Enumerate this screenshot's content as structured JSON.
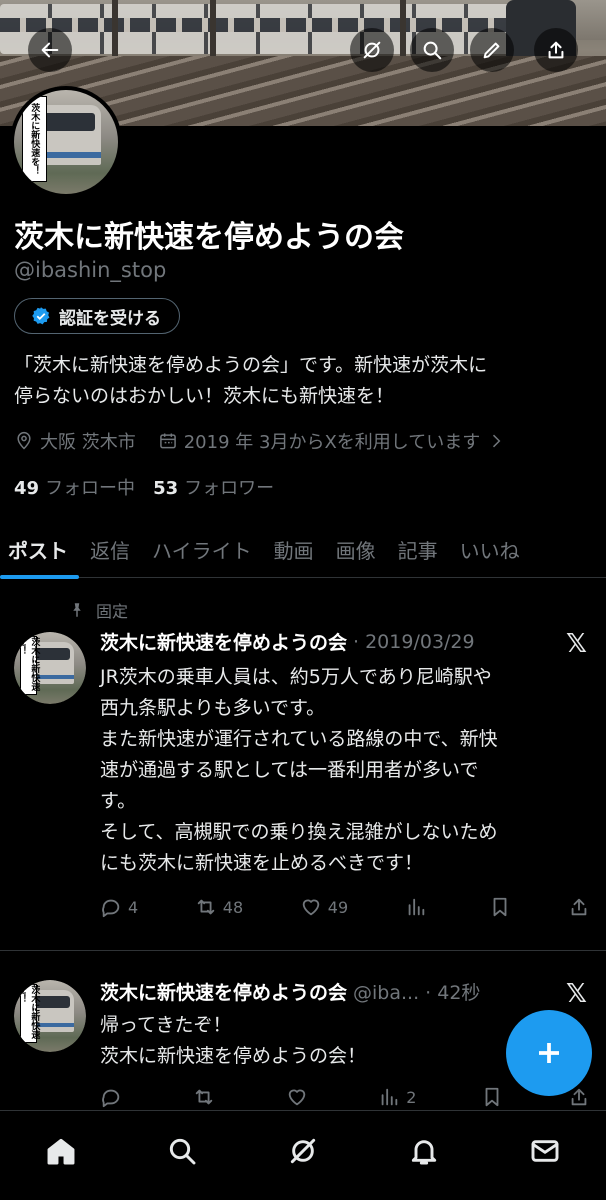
{
  "profile": {
    "name": "茨木に新快速を停めようの会",
    "handle": "@ibashin_stop",
    "verify_label": "認証を受ける",
    "bio_line1": "「茨木に新快速を停めようの会」です。新快速が茨木に",
    "bio_line2": "停らないのはおかしい！茨木にも新快速を！",
    "location": "大阪 茨木市",
    "joined": "2019 年 3月からXを利用しています",
    "following_count": "49",
    "following_label": "フォロー中",
    "followers_count": "53",
    "followers_label": "フォロワー",
    "avatar_text": "茨木に新快速を！"
  },
  "tabs": [
    "ポスト",
    "返信",
    "ハイライト",
    "動画",
    "画像",
    "記事",
    "いいね"
  ],
  "posts": [
    {
      "pinned_label": "固定",
      "author": "茨木に新快速を停めようの会",
      "meta": "· 2019/03/29",
      "text": "JR茨木の乗車人員は、約5万人であり尼崎駅や\n西九条駅よりも多いです。\nまた新快速が運行されている路線の中で、新快\n速が通過する駅としては一番利用者が多いで\nす。\nそして、高槻駅での乗り換え混雑がしないため\nにも茨木に新快速を止めるべきです！",
      "replies": "4",
      "reposts": "48",
      "likes": "49",
      "views": ""
    },
    {
      "author": "茨木に新快速を停めようの会",
      "meta": "@iba... · 42秒",
      "text": "帰ってきたぞ！\n茨木に新快速を停めようの会！",
      "replies": "",
      "reposts": "",
      "likes": "",
      "views": "2"
    }
  ],
  "colors": {
    "accent": "#1d9bf0",
    "muted": "#71767b",
    "background": "#000000"
  },
  "icons": {
    "header": [
      "back-arrow-icon",
      "grok-icon",
      "search-icon",
      "edit-icon",
      "share-icon"
    ],
    "nav": [
      "home-icon",
      "search-icon",
      "grok-icon",
      "bell-icon",
      "mail-icon"
    ]
  }
}
